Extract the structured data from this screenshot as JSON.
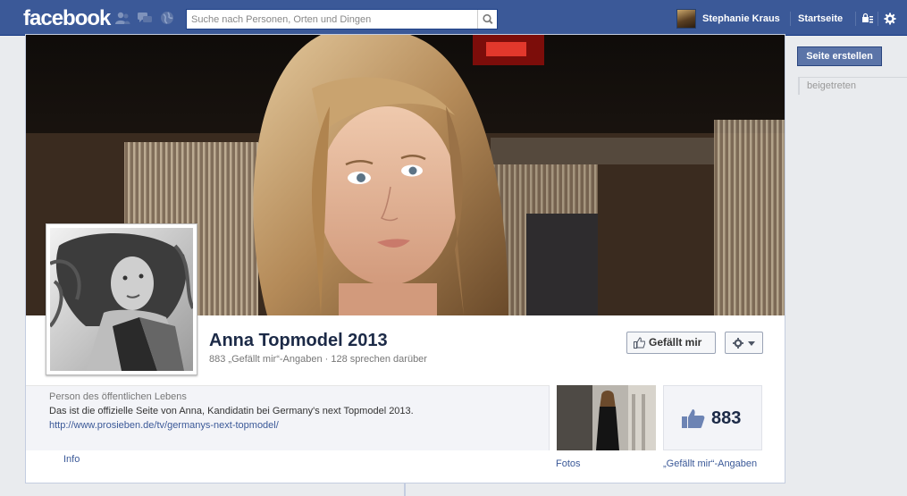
{
  "topbar": {
    "logo": "facebook",
    "search_placeholder": "Suche nach Personen, Orten und Dingen",
    "username": "Stephanie Kraus",
    "home": "Startseite"
  },
  "sidebar": {
    "create_page": "Seite erstellen",
    "joined": "beigetreten"
  },
  "page": {
    "name": "Anna Topmodel 2013",
    "stats": "883 „Gefällt mir“-Angaben · 128 sprechen darüber",
    "like_button": "Gefällt mir",
    "category": "Person des öffentlichen Lebens",
    "description": "Das ist die offizielle Seite von Anna, Kandidatin bei Germany's next Topmodel 2013.",
    "url": "http://www.prosieben.de/tv/germanys-next-topmodel/",
    "info_tab": "Info",
    "photos_tab": "Fotos",
    "likes_count": "883",
    "likes_tab": "„Gefällt mir“-Angaben"
  },
  "colors": {
    "brand_blue": "#3b5998",
    "dark_navy": "#1c2a47"
  },
  "icons": [
    "friend-requests-icon",
    "messages-icon",
    "notifications-icon",
    "search-icon",
    "privacy-icon",
    "settings-gear-icon",
    "thumbs-up-icon",
    "chevron-down-icon"
  ]
}
